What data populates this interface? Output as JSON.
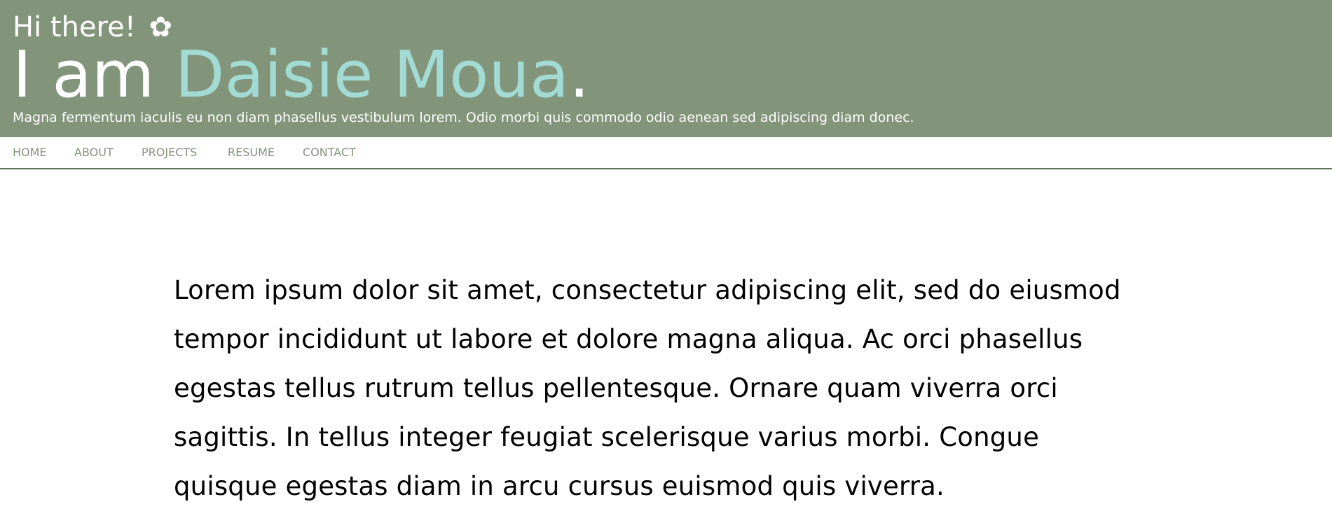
{
  "header": {
    "greeting": "Hi there!",
    "flower_icon": "✿",
    "intro_prefix": "I am ",
    "name": "Daisie Moua",
    "intro_suffix": ".",
    "tagline": "Magna fermentum iaculis eu non diam phasellus vestibulum lorem. Odio morbi quis commodo odio aenean sed adipiscing diam donec."
  },
  "nav": {
    "items": [
      "HOME",
      "ABOUT",
      "PROJECTS",
      "RESUME",
      "CONTACT"
    ]
  },
  "main": {
    "paragraph": "Lorem ipsum dolor sit amet, consectetur adipiscing elit, sed do eiusmod tempor incididunt ut labore et dolore magna aliqua. Ac orci phasellus egestas tellus rutrum tellus pellentesque. Ornare quam viverra orci sagittis. In tellus integer feugiat scelerisque varius morbi. Congue quisque egestas diam in arcu cursus euismod quis viverra."
  },
  "colors": {
    "header_bg": "#82957b",
    "name_accent": "#a2dad4",
    "nav_text": "#82957b"
  }
}
